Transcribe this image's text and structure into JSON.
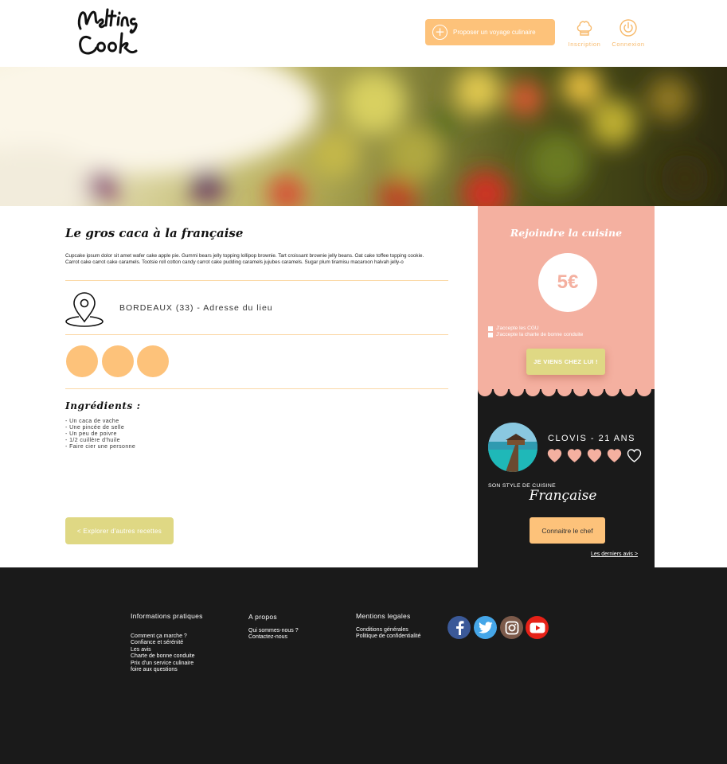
{
  "header": {
    "logo_text": "Melting Cook",
    "propose_label": "Proposer un voyage culinaire",
    "inscription_label": "Inscription",
    "connexion_label": "Connexion"
  },
  "recipe": {
    "title": "Le gros caca à la française",
    "description": "Cupcake ipsum dolor sit amet wafer cake apple pie. Gummi bears jelly topping lollipop brownie. Tart croissant brownie jelly beans. Oat cake toffee topping cookie. Carrot cake carrot cake caramels. Tootsie roll cotton candy carrot cake pudding caramels jujubes caramels. Sugar plum tiramisu macaroon halvah jelly-o",
    "location": "BORDEAUX (33) - Adresse du lieu",
    "ingredients_title": "Ingrédients :",
    "ingredients": [
      "- Un caca de vache",
      "- Une pincée de selle",
      "- Un peu de poivre",
      "- 1/2 cuillère d'huile",
      "- Faire cier une personne"
    ],
    "explore_label": "< Explorer d'autres recettes"
  },
  "booking": {
    "title": "Rejoindre la cuisine",
    "price": "5€",
    "cgu_label": "J'accepte les CGU",
    "charter_label": "J'accepte la charte de bonne conduite",
    "cta_label": "JE VIENS CHEZ LUI !"
  },
  "chef": {
    "name_age": "CLOVIS - 21 ANS",
    "rating": 4,
    "rating_max": 5,
    "style_label": "SON STYLE DE CUISINE",
    "style_value": "Française",
    "meet_label": "Connaitre le chef",
    "reviews_label": "Les derniers avis >"
  },
  "footer": {
    "info": {
      "heading": "Informations pratiques",
      "links": [
        "Comment ça marche ?",
        "Confiance et sérénité",
        "Les avis",
        "Charte de bonne conduite",
        "Prix d'un service culinaire",
        "foire aux questions"
      ]
    },
    "about": {
      "heading": "A propos",
      "links": [
        "Qui sommes-nous ?",
        "Contactez-nous"
      ]
    },
    "legal": {
      "heading": "Mentions legales",
      "links": [
        "Conditions générales",
        "Politique de confidentialité"
      ]
    },
    "social": [
      "facebook-icon",
      "twitter-icon",
      "instagram-icon",
      "youtube-icon"
    ]
  },
  "colors": {
    "orange": "#fdc27a",
    "pink": "#f4b0a0",
    "olive": "#dfd884",
    "dark": "#1a1a1a"
  }
}
